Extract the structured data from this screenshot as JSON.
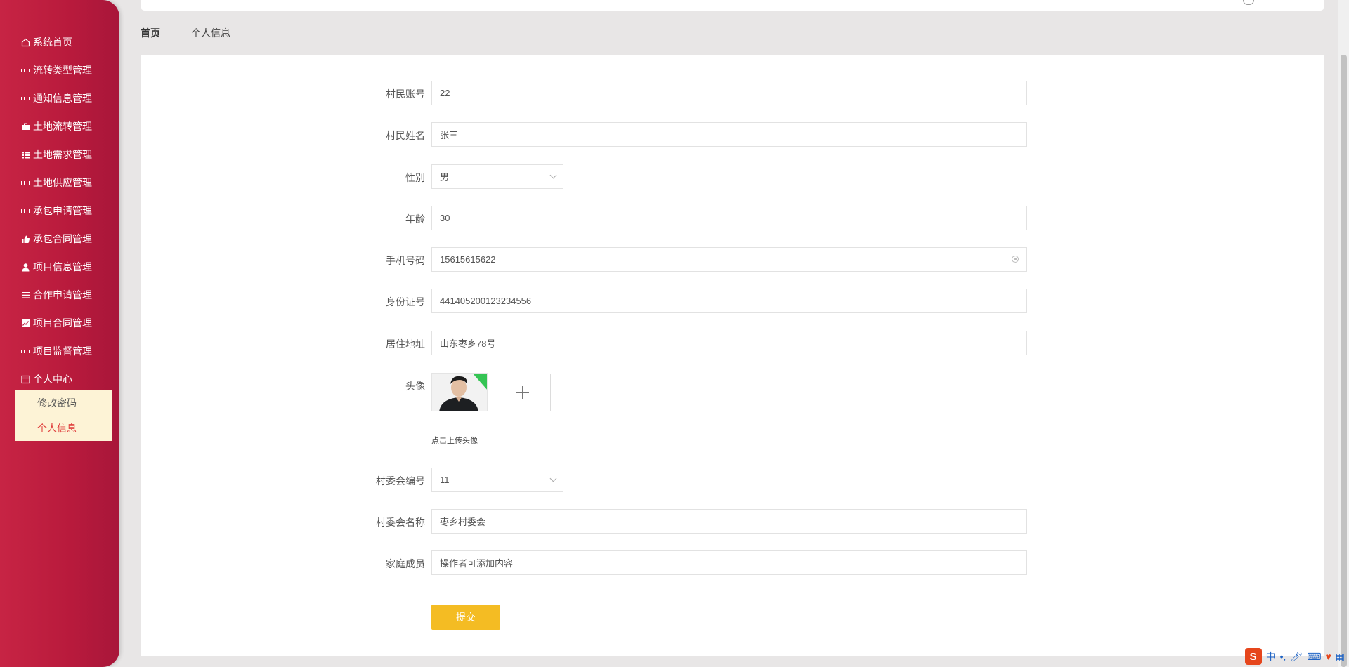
{
  "sidebar": {
    "items": [
      {
        "label": "系统首页",
        "icon": "home-icon"
      },
      {
        "label": "流转类型管理",
        "icon": "grid-icon"
      },
      {
        "label": "通知信息管理",
        "icon": "grid-icon"
      },
      {
        "label": "土地流转管理",
        "icon": "briefcase-icon"
      },
      {
        "label": "土地需求管理",
        "icon": "table-icon"
      },
      {
        "label": "土地供应管理",
        "icon": "grid-icon"
      },
      {
        "label": "承包申请管理",
        "icon": "grid-icon"
      },
      {
        "label": "承包合同管理",
        "icon": "thumbs-up-icon"
      },
      {
        "label": "项目信息管理",
        "icon": "user-icon"
      },
      {
        "label": "合作申请管理",
        "icon": "list-icon"
      },
      {
        "label": "项目合同管理",
        "icon": "chart-icon"
      },
      {
        "label": "项目监督管理",
        "icon": "grid-icon"
      },
      {
        "label": "个人中心",
        "icon": "window-icon"
      }
    ],
    "submenu": [
      {
        "label": "修改密码"
      },
      {
        "label": "个人信息"
      }
    ]
  },
  "breadcrumb": {
    "home": "首页",
    "separator": "——",
    "current": "个人信息"
  },
  "form": {
    "account": {
      "label": "村民账号",
      "value": "22"
    },
    "name": {
      "label": "村民姓名",
      "value": "张三"
    },
    "gender": {
      "label": "性别",
      "value": "男"
    },
    "age": {
      "label": "年龄",
      "value": "30"
    },
    "phone": {
      "label": "手机号码",
      "value": "15615615622"
    },
    "id_number": {
      "label": "身份证号",
      "value": "441405200123234556"
    },
    "address": {
      "label": "居住地址",
      "value": "山东枣乡78号"
    },
    "avatar": {
      "label": "头像",
      "hint": "点击上传头像"
    },
    "committee_id": {
      "label": "村委会编号",
      "value": "11"
    },
    "committee_name": {
      "label": "村委会名称",
      "value": "枣乡村委会"
    },
    "family": {
      "label": "家庭成员",
      "value": "操作者可添加内容"
    },
    "submit_label": "提交"
  },
  "taskbar": {
    "ime_logo": "S",
    "ime_mode": "中"
  },
  "colors": {
    "sidebar": "#b81a3c",
    "accent_button": "#f4bc23",
    "active_submenu": "#e0413f",
    "submenu_bg": "#fdf3d6"
  }
}
